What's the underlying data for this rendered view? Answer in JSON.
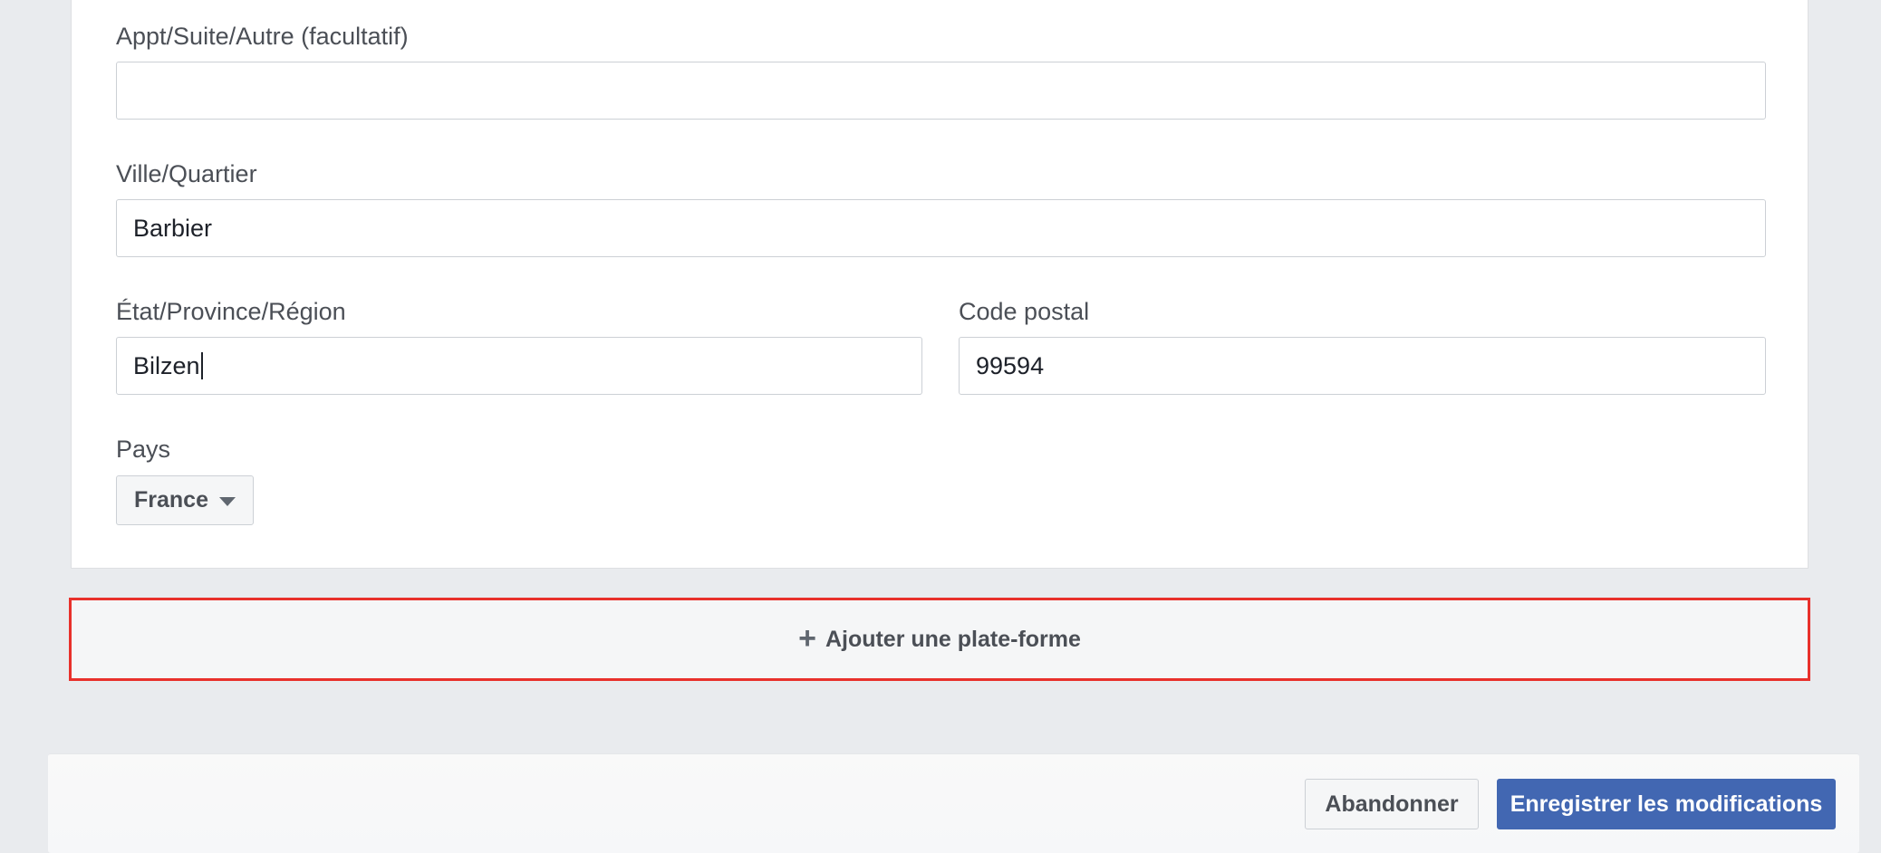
{
  "form": {
    "apt": {
      "label": "Appt/Suite/Autre (facultatif)",
      "value": ""
    },
    "city": {
      "label": "Ville/Quartier",
      "value": "Barbier"
    },
    "state": {
      "label": "État/Province/Région",
      "value": "Bilzen"
    },
    "zip": {
      "label": "Code postal",
      "value": "99594"
    },
    "country": {
      "label": "Pays",
      "value": "France"
    }
  },
  "add_platform": {
    "label": "Ajouter une plate-forme",
    "icon": "plus-icon"
  },
  "footer": {
    "cancel_label": "Abandonner",
    "save_label": "Enregistrer les modifications"
  },
  "colors": {
    "primary": "#4267b2",
    "highlight": "#e8302b",
    "background": "#e9ebee"
  }
}
